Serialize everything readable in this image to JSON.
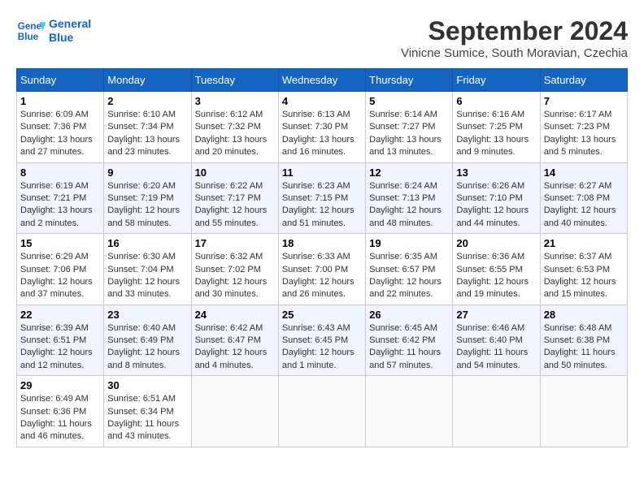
{
  "header": {
    "logo_line1": "General",
    "logo_line2": "Blue",
    "month_title": "September 2024",
    "location": "Vinicne Sumice, South Moravian, Czechia"
  },
  "weekdays": [
    "Sunday",
    "Monday",
    "Tuesday",
    "Wednesday",
    "Thursday",
    "Friday",
    "Saturday"
  ],
  "weeks": [
    [
      {
        "day": "1",
        "info": "Sunrise: 6:09 AM\nSunset: 7:36 PM\nDaylight: 13 hours\nand 27 minutes."
      },
      {
        "day": "2",
        "info": "Sunrise: 6:10 AM\nSunset: 7:34 PM\nDaylight: 13 hours\nand 23 minutes."
      },
      {
        "day": "3",
        "info": "Sunrise: 6:12 AM\nSunset: 7:32 PM\nDaylight: 13 hours\nand 20 minutes."
      },
      {
        "day": "4",
        "info": "Sunrise: 6:13 AM\nSunset: 7:30 PM\nDaylight: 13 hours\nand 16 minutes."
      },
      {
        "day": "5",
        "info": "Sunrise: 6:14 AM\nSunset: 7:27 PM\nDaylight: 13 hours\nand 13 minutes."
      },
      {
        "day": "6",
        "info": "Sunrise: 6:16 AM\nSunset: 7:25 PM\nDaylight: 13 hours\nand 9 minutes."
      },
      {
        "day": "7",
        "info": "Sunrise: 6:17 AM\nSunset: 7:23 PM\nDaylight: 13 hours\nand 5 minutes."
      }
    ],
    [
      {
        "day": "8",
        "info": "Sunrise: 6:19 AM\nSunset: 7:21 PM\nDaylight: 13 hours\nand 2 minutes."
      },
      {
        "day": "9",
        "info": "Sunrise: 6:20 AM\nSunset: 7:19 PM\nDaylight: 12 hours\nand 58 minutes."
      },
      {
        "day": "10",
        "info": "Sunrise: 6:22 AM\nSunset: 7:17 PM\nDaylight: 12 hours\nand 55 minutes."
      },
      {
        "day": "11",
        "info": "Sunrise: 6:23 AM\nSunset: 7:15 PM\nDaylight: 12 hours\nand 51 minutes."
      },
      {
        "day": "12",
        "info": "Sunrise: 6:24 AM\nSunset: 7:13 PM\nDaylight: 12 hours\nand 48 minutes."
      },
      {
        "day": "13",
        "info": "Sunrise: 6:26 AM\nSunset: 7:10 PM\nDaylight: 12 hours\nand 44 minutes."
      },
      {
        "day": "14",
        "info": "Sunrise: 6:27 AM\nSunset: 7:08 PM\nDaylight: 12 hours\nand 40 minutes."
      }
    ],
    [
      {
        "day": "15",
        "info": "Sunrise: 6:29 AM\nSunset: 7:06 PM\nDaylight: 12 hours\nand 37 minutes."
      },
      {
        "day": "16",
        "info": "Sunrise: 6:30 AM\nSunset: 7:04 PM\nDaylight: 12 hours\nand 33 minutes."
      },
      {
        "day": "17",
        "info": "Sunrise: 6:32 AM\nSunset: 7:02 PM\nDaylight: 12 hours\nand 30 minutes."
      },
      {
        "day": "18",
        "info": "Sunrise: 6:33 AM\nSunset: 7:00 PM\nDaylight: 12 hours\nand 26 minutes."
      },
      {
        "day": "19",
        "info": "Sunrise: 6:35 AM\nSunset: 6:57 PM\nDaylight: 12 hours\nand 22 minutes."
      },
      {
        "day": "20",
        "info": "Sunrise: 6:36 AM\nSunset: 6:55 PM\nDaylight: 12 hours\nand 19 minutes."
      },
      {
        "day": "21",
        "info": "Sunrise: 6:37 AM\nSunset: 6:53 PM\nDaylight: 12 hours\nand 15 minutes."
      }
    ],
    [
      {
        "day": "22",
        "info": "Sunrise: 6:39 AM\nSunset: 6:51 PM\nDaylight: 12 hours\nand 12 minutes."
      },
      {
        "day": "23",
        "info": "Sunrise: 6:40 AM\nSunset: 6:49 PM\nDaylight: 12 hours\nand 8 minutes."
      },
      {
        "day": "24",
        "info": "Sunrise: 6:42 AM\nSunset: 6:47 PM\nDaylight: 12 hours\nand 4 minutes."
      },
      {
        "day": "25",
        "info": "Sunrise: 6:43 AM\nSunset: 6:45 PM\nDaylight: 12 hours\nand 1 minute."
      },
      {
        "day": "26",
        "info": "Sunrise: 6:45 AM\nSunset: 6:42 PM\nDaylight: 11 hours\nand 57 minutes."
      },
      {
        "day": "27",
        "info": "Sunrise: 6:46 AM\nSunset: 6:40 PM\nDaylight: 11 hours\nand 54 minutes."
      },
      {
        "day": "28",
        "info": "Sunrise: 6:48 AM\nSunset: 6:38 PM\nDaylight: 11 hours\nand 50 minutes."
      }
    ],
    [
      {
        "day": "29",
        "info": "Sunrise: 6:49 AM\nSunset: 6:36 PM\nDaylight: 11 hours\nand 46 minutes."
      },
      {
        "day": "30",
        "info": "Sunrise: 6:51 AM\nSunset: 6:34 PM\nDaylight: 11 hours\nand 43 minutes."
      },
      {
        "day": "",
        "info": ""
      },
      {
        "day": "",
        "info": ""
      },
      {
        "day": "",
        "info": ""
      },
      {
        "day": "",
        "info": ""
      },
      {
        "day": "",
        "info": ""
      }
    ]
  ]
}
